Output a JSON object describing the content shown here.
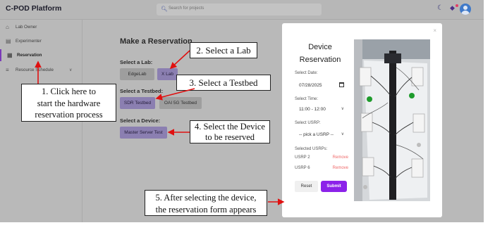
{
  "app": {
    "title": "C-POD Platform"
  },
  "search": {
    "placeholder": "Search for projects"
  },
  "icons": {
    "search": "search-icon",
    "theme": "moon-icon",
    "notifications": "bell-icon",
    "profile": "user-avatar-icon"
  },
  "sidebar": {
    "items": [
      {
        "label": "Lab Owner",
        "icon": "home-icon"
      },
      {
        "label": "Experimenter",
        "icon": "briefcase-icon"
      },
      {
        "label": "Reservation",
        "icon": "calendar-icon"
      },
      {
        "label": "Resource Schedule",
        "icon": "list-icon"
      }
    ]
  },
  "main": {
    "title": "Make a Reservation",
    "lab_label": "Select a Lab:",
    "labs": [
      "EdgeLab",
      "X Lab"
    ],
    "testbed_label": "Select a Testbed:",
    "testbeds": [
      "SDR Testbed",
      "OAI 5G Testbed"
    ],
    "device_label": "Select a Device:",
    "device_button": "Master Server Test"
  },
  "modal": {
    "close": "×",
    "title_line1": "Device",
    "title_line2": "Reservation",
    "date_label": "Select Date:",
    "date_value": "07/28/2025",
    "time_label": "Select Time:",
    "time_value": "11:00 - 12:00",
    "usrp_label": "Select USRP:",
    "usrp_value": "-- pick a USRP --",
    "selected_label": "Selected USRPs:",
    "selected": [
      {
        "name": "USRP 2",
        "action": "Remove"
      },
      {
        "name": "USRP 6",
        "action": "Remove"
      }
    ],
    "reset": "Reset",
    "submit": "Submit"
  },
  "annotations": {
    "step1_line1": "1. Click here to",
    "step1_line2": "start the hardware",
    "step1_line3": "reservation process",
    "step2": "2. Select a Lab",
    "step3": "3. Select a Testbed",
    "step4_line1": "4. Select the Device",
    "step4_line2": "to be reserved",
    "step5_line1": "5. After selecting the device,",
    "step5_line2": "the reservation form appears",
    "arrow_color": "#e01010"
  },
  "colors": {
    "accent": "#8c22e9",
    "selected_button": "#8b7fb1",
    "remove": "#ef6a6a"
  }
}
